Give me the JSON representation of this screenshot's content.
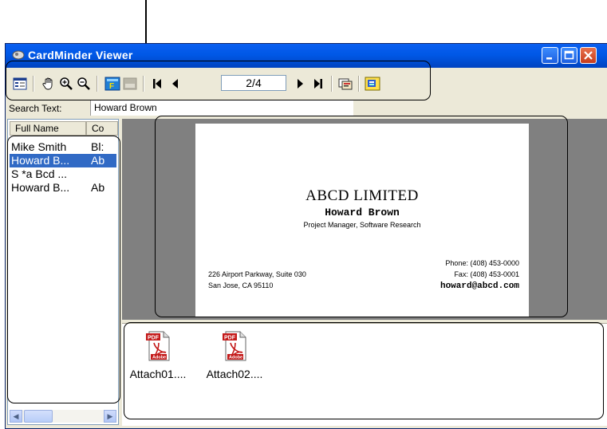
{
  "window": {
    "title": "CardMinder Viewer"
  },
  "toolbar": {
    "icons": [
      "list-view-icon",
      "hand-icon",
      "zoom-in-icon",
      "zoom-out-icon",
      "front-side-icon",
      "back-side-icon",
      "first-page-icon",
      "prev-page-icon",
      "next-page-icon",
      "last-page-icon",
      "copy-card-icon",
      "export-icon"
    ],
    "page_indicator": "2/4"
  },
  "search": {
    "label": "Search Text:",
    "value": "Howard Brown"
  },
  "list": {
    "columns": [
      "Full Name",
      "Co"
    ],
    "rows": [
      {
        "name": "Mike Smith",
        "company": "Bl:",
        "selected": false
      },
      {
        "name": "Howard B...",
        "company": "Ab",
        "selected": true
      },
      {
        "name": "S *a Bcd ...",
        "company": "",
        "selected": false
      },
      {
        "name": "Howard B...",
        "company": "Ab",
        "selected": false
      }
    ]
  },
  "card": {
    "company": "ABCD LIMITED",
    "name": "Howard Brown",
    "title": "Project Manager, Software Research",
    "address_line1": "226 Airport Parkway, Suite 030",
    "address_line2": "San Jose, CA 95110",
    "phone": "Phone: (408) 453-0000",
    "fax": "Fax: (408) 453-0001",
    "email": "howard@abcd.com"
  },
  "attachments": [
    {
      "label": "Attach01....",
      "badge": "PDF",
      "brand": "Adobe"
    },
    {
      "label": "Attach02....",
      "badge": "PDF",
      "brand": "Adobe"
    }
  ],
  "colors": {
    "title_bar": "#0058e6",
    "selection": "#316ac5",
    "viewer_background": "#808080"
  }
}
